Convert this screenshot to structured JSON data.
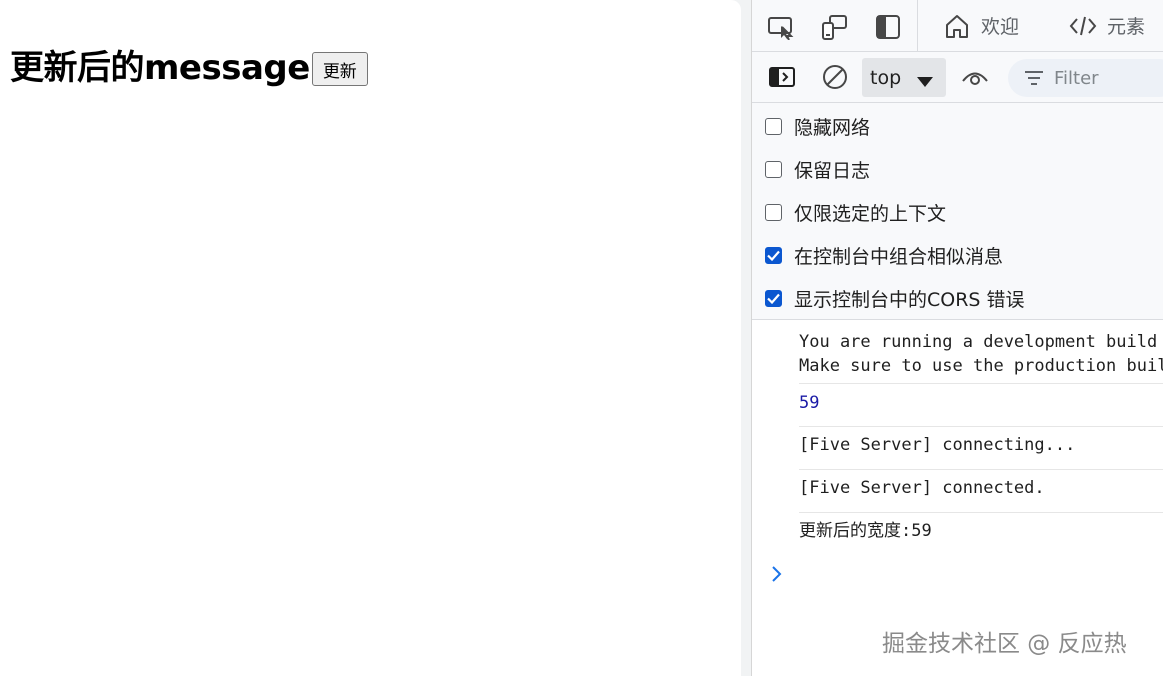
{
  "page": {
    "heading": "更新后的message",
    "update_button_label": "更新"
  },
  "devtools": {
    "tabs": [
      {
        "label": "欢迎",
        "icon": "home-icon"
      },
      {
        "label": "元素",
        "icon": "code-icon"
      }
    ],
    "toolbar": {
      "context_value": "top",
      "filter_placeholder": "Filter"
    },
    "settings": [
      {
        "label": "隐藏网络",
        "checked": false
      },
      {
        "label": "保留日志",
        "checked": false
      },
      {
        "label": "仅限选定的上下文",
        "checked": false
      },
      {
        "label": "在控制台中组合相似消息",
        "checked": true
      },
      {
        "label": "显示控制台中的CORS 错误",
        "checked": true
      }
    ],
    "console_messages": [
      {
        "text": "You are running a development build of Vue.\nMake sure to use the production build"
      },
      {
        "text": "59"
      },
      {
        "text": "[Five Server] connecting..."
      },
      {
        "text": "[Five Server] connected."
      },
      {
        "text": "更新后的宽度:59"
      }
    ]
  },
  "watermark": "掘金技术社区 @ 反应热",
  "colors": {
    "accent": "#0b57d0",
    "number": "#1a1aa6"
  }
}
